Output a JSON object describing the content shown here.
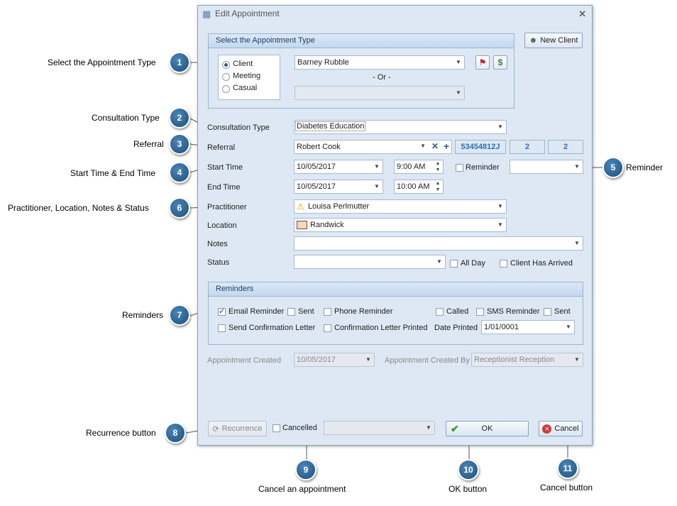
{
  "callouts": [
    {
      "num": "1",
      "label": "Select the Appointment Type"
    },
    {
      "num": "2",
      "label": "Consultation Type"
    },
    {
      "num": "3",
      "label": "Referral"
    },
    {
      "num": "4",
      "label": "Start Time & End Time"
    },
    {
      "num": "5",
      "label": "Reminder"
    },
    {
      "num": "6",
      "label": "Practitioner, Location, Notes & Status"
    },
    {
      "num": "7",
      "label": "Reminders"
    },
    {
      "num": "8",
      "label": "Recurrence button"
    },
    {
      "num": "9",
      "label": "Cancel an appointment"
    },
    {
      "num": "10",
      "label": "OK button"
    },
    {
      "num": "11",
      "label": "Cancel button"
    }
  ],
  "dialog": {
    "title": "Edit Appointment",
    "close": "✕",
    "new_client_label": "New Client",
    "appt_type": {
      "header": "Select the Appointment Type",
      "options": [
        "Client",
        "Meeting",
        "Casual"
      ],
      "selected": "Client",
      "client_value": "Barney Rubble",
      "or_text": "- Or -",
      "other_value": ""
    },
    "consultation": {
      "label": "Consultation Type",
      "value": "Diabetes Education"
    },
    "referral": {
      "label": "Referral",
      "value": "Robert Cook",
      "id": "53454812J",
      "count1": "2",
      "count2": "2"
    },
    "start": {
      "label": "Start Time",
      "date": "10/05/2017",
      "time": "9:00 AM"
    },
    "reminder": {
      "label": "Reminder",
      "value": ""
    },
    "end": {
      "label": "End Time",
      "date": "10/05/2017",
      "time": "10:00 AM"
    },
    "practitioner": {
      "label": "Practitioner",
      "value": "Louisa Perlmutter"
    },
    "location": {
      "label": "Location",
      "value": "Randwick"
    },
    "notes": {
      "label": "Notes",
      "value": ""
    },
    "status": {
      "label": "Status",
      "value": "",
      "all_day": "All Day",
      "client_arrived": "Client Has Arrived"
    },
    "reminders": {
      "header": "Reminders",
      "email_reminder": "Email Reminder",
      "sent": "Sent",
      "phone_reminder": "Phone Reminder",
      "called": "Called",
      "sms_reminder": "SMS Reminder",
      "sent2": "Sent",
      "send_confirmation": "Send Confirmation Letter",
      "confirmation_printed": "Confirmation Letter Printed",
      "date_printed_label": "Date Printed",
      "date_printed_value": "1/01/0001"
    },
    "created": {
      "label": "Appointment Created",
      "value": "10/05/2017",
      "by_label": "Appointment Created By",
      "by_value": "Receptionist Reception"
    },
    "footer": {
      "recurrence": "Recurrence",
      "cancelled": "Cancelled",
      "cancel_reason": "",
      "ok": "OK",
      "cancel": "Cancel"
    }
  },
  "colors": {
    "accent": "#2f6fb3",
    "badge": "#2f6690",
    "dialog_bg": "#dde8f4"
  }
}
